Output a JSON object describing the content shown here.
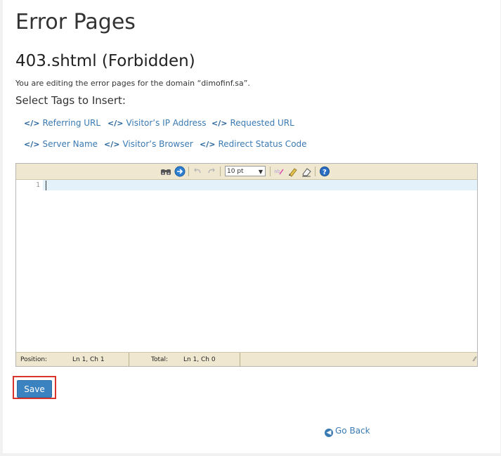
{
  "page": {
    "title": "Error Pages",
    "subtitle": "403.shtml (Forbidden)",
    "description": "You are editing the error pages for the domain “dimofinf.sa”.",
    "tags_heading": "Select Tags to Insert:"
  },
  "tags": [
    {
      "label": "Referring URL",
      "icon": "code-icon"
    },
    {
      "label": "Visitor’s IP Address",
      "icon": "code-icon"
    },
    {
      "label": "Requested URL",
      "icon": "code-icon"
    },
    {
      "label": "Server Name",
      "icon": "code-icon"
    },
    {
      "label": "Visitor’s Browser",
      "icon": "code-icon"
    },
    {
      "label": "Redirect Status Code",
      "icon": "code-icon"
    }
  ],
  "tag_icon_glyph": "</>",
  "editor": {
    "font_size": "10 pt",
    "line_number": "1",
    "status": {
      "position_label": "Position:",
      "position_value": "Ln 1, Ch 1",
      "total_label": "Total:",
      "total_value": "Ln 1, Ch 0"
    },
    "toolbar_icons": [
      "search-icon",
      "goto-line-icon",
      "undo-icon",
      "redo-icon",
      "font-size-select",
      "syntax-toggle-icon",
      "highlight-icon",
      "reset-icon",
      "help-icon"
    ]
  },
  "actions": {
    "save_label": "Save",
    "go_back_label": "Go Back"
  },
  "colors": {
    "link": "#3a7ab3",
    "save_button": "#3b83c0",
    "highlight_border": "#d9342b",
    "toolbar_bg": "#efe7cf"
  }
}
